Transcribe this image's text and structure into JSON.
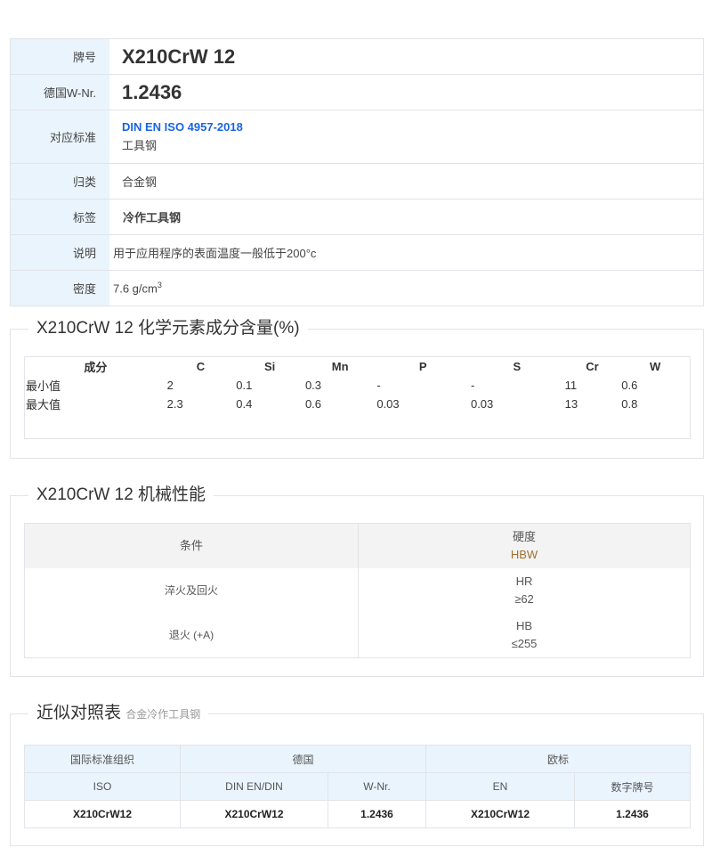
{
  "info": {
    "grade_label": "牌号",
    "grade_value": "X210CrW 12",
    "wnr_label": "德国W-Nr.",
    "wnr_value": "1.2436",
    "standard_label": "对应标准",
    "standard_link": "DIN EN ISO 4957-2018",
    "standard_desc": "工具钢",
    "category_label": "归类",
    "category_value": "合金钢",
    "tag_label": "标签",
    "tag_value": "冷作工具钢",
    "desc_label": "说明",
    "desc_value": "用于应用程序的表面温度一般低于200°c",
    "density_label": "密度",
    "density_value": "7.6 g/cm",
    "density_exp": "3"
  },
  "chem": {
    "title": "X210CrW 12 化学元素成分含量(%)",
    "headers": [
      "成分",
      "C",
      "Si",
      "Mn",
      "P",
      "S",
      "Cr",
      "W"
    ],
    "rows": [
      [
        "最小值",
        "2",
        "0.1",
        "0.3",
        "-",
        "-",
        "11",
        "0.6"
      ],
      [
        "最大值",
        "2.3",
        "0.4",
        "0.6",
        "0.03",
        "0.03",
        "13",
        "0.8"
      ]
    ]
  },
  "mech": {
    "title": "X210CrW 12 机械性能",
    "col1_header": "条件",
    "col2_header": "硬度",
    "col2_unit": "HBW",
    "rows": [
      {
        "condition": "淬火及回火",
        "scale": "HR",
        "value": "≥62"
      },
      {
        "condition": "退火 (+A)",
        "scale": "HB",
        "value": "≤255"
      }
    ]
  },
  "equiv": {
    "title": "近似对照表",
    "subtitle": "合金冷作工具钢",
    "groups": [
      "国际标准组织",
      "德国",
      "欧标"
    ],
    "columns": [
      "ISO",
      "DIN EN/DIN",
      "W-Nr.",
      "EN",
      "数字牌号"
    ],
    "row": [
      "X210CrW12",
      "X210CrW12",
      "1.2436",
      "X210CrW12",
      "1.2436"
    ]
  },
  "chart_data": {
    "type": "table",
    "title": "X210CrW 12 化学元素成分含量(%)",
    "columns": [
      "成分",
      "C",
      "Si",
      "Mn",
      "P",
      "S",
      "Cr",
      "W"
    ],
    "rows": [
      [
        "最小值",
        2,
        0.1,
        0.3,
        "-",
        "-",
        11,
        0.6
      ],
      [
        "最大值",
        2.3,
        0.4,
        0.6,
        0.03,
        0.03,
        13,
        0.8
      ]
    ]
  }
}
